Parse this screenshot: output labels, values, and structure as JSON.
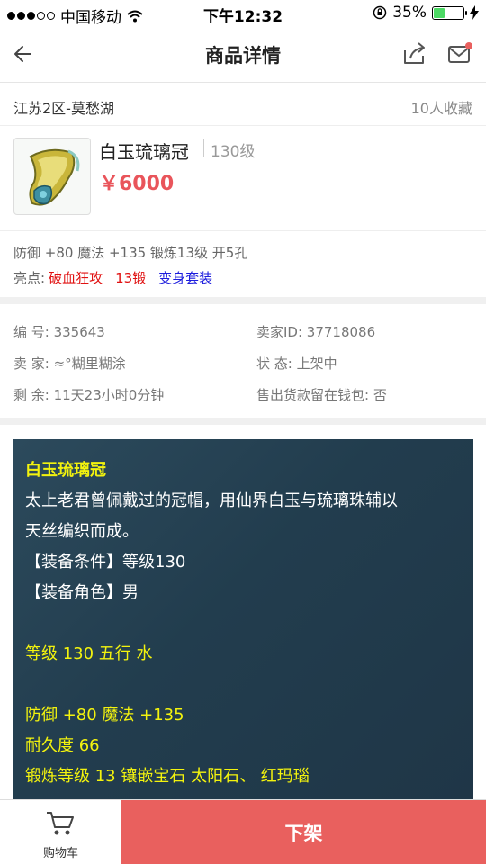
{
  "status_bar": {
    "carrier": "中国移动",
    "time": "下午12:32",
    "battery": "35%",
    "battery_level": 0.35
  },
  "nav": {
    "title": "商品详情"
  },
  "server": {
    "name": "江苏2区-莫愁湖",
    "favorites": "10人收藏"
  },
  "product": {
    "name": "白玉琉璃冠",
    "level": "130级",
    "price": "￥6000"
  },
  "attributes": {
    "line": "防御 +80 魔法 +135 锻炼13级 开5孔",
    "highlight_label": "亮点:",
    "highlights": [
      "破血狂攻",
      "13锻",
      "变身套装"
    ]
  },
  "info": {
    "serial": "编  号: 335643",
    "seller_id": "卖家ID: 37718086",
    "seller": "卖  家: ≈°糊里糊涂",
    "status": "状  态: 上架中",
    "remaining": "剩  余: 11天23小时0分钟",
    "wallet": "售出货款留在钱包: 否"
  },
  "description": {
    "title": "白玉琉璃冠",
    "lines": [
      "太上老君曾佩戴过的冠帽，用仙界白玉与琉璃珠辅以",
      "天丝编织而成。",
      "【装备条件】等级130",
      "【装备角色】男"
    ],
    "stats": [
      "等级 130 五行 水",
      "",
      "防御 +80 魔法 +135",
      "耐久度 66",
      "锻炼等级 13 镶嵌宝石 太阳石、 红玛瑙"
    ]
  },
  "bottom": {
    "cart_label": "购物车",
    "delist_label": "下架"
  },
  "colors": {
    "accent_red": "#e9605e",
    "price_red": "#e9555b",
    "highlight_blue": "#1d1ddd",
    "desc_bg": "#223d4e",
    "desc_yellow": "#f3f30e"
  }
}
